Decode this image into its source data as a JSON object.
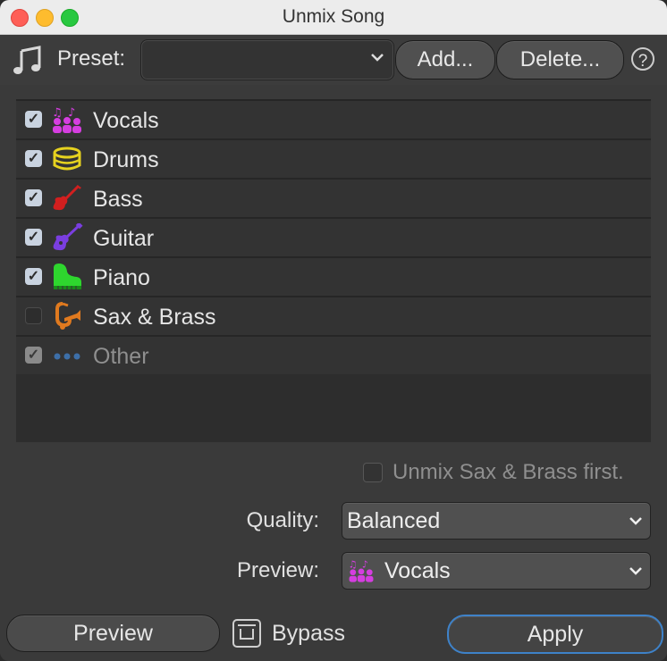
{
  "window": {
    "title": "Unmix Song"
  },
  "toolbar": {
    "preset_label": "Preset:",
    "preset_value": "",
    "add_label": "Add...",
    "delete_label": "Delete...",
    "help_label": "?"
  },
  "stems": [
    {
      "label": "Vocals",
      "checked": true,
      "icon": "vocals-icon",
      "color": "#d53ee0"
    },
    {
      "label": "Drums",
      "checked": true,
      "icon": "drum-icon",
      "color": "#e6d21f"
    },
    {
      "label": "Bass",
      "checked": true,
      "icon": "bass-guitar-icon",
      "color": "#d21f1f"
    },
    {
      "label": "Guitar",
      "checked": true,
      "icon": "guitar-icon",
      "color": "#7a3ee0"
    },
    {
      "label": "Piano",
      "checked": true,
      "icon": "piano-icon",
      "color": "#2ed62e"
    },
    {
      "label": "Sax & Brass",
      "checked": false,
      "icon": "sax-brass-icon",
      "color": "#e07a1f"
    },
    {
      "label": "Other",
      "checked": true,
      "disabled": true,
      "icon": "ellipsis-icon",
      "color": "#3d6fa8"
    }
  ],
  "options": {
    "unmix_first_label": "Unmix Sax & Brass first.",
    "unmix_first_checked": false,
    "quality_label": "Quality:",
    "quality_value": "Balanced",
    "preview_label": "Preview:",
    "preview_value": "Vocals"
  },
  "footer": {
    "preview_button": "Preview",
    "bypass_label": "Bypass",
    "apply_button": "Apply"
  }
}
